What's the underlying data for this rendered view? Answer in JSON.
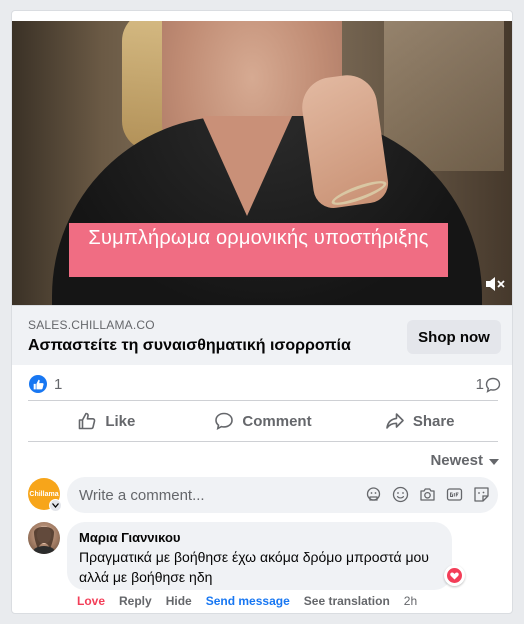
{
  "post": {
    "video_caption": "Συμπλήρωμα ορμονικής υποστήριξης",
    "link": {
      "domain": "SALES.CHILLAMA.CO",
      "headline": "Ασπαστείτε τη συναισθηματική ισορροπία",
      "cta_label": "Shop now"
    },
    "reactions": {
      "count": "1",
      "comments_count": "1"
    },
    "actions": {
      "like": "Like",
      "comment": "Comment",
      "share": "Share"
    },
    "sort_label": "Newest"
  },
  "composer": {
    "avatar_text": "Chillama",
    "placeholder": "Write a comment..."
  },
  "comments": [
    {
      "author": "Μαρια Γιαννικου",
      "text": "Πραγματικά με βοήθησε έχω ακόμα δρόμο μπροστά μου αλλά με βοήθησε ηδη",
      "actions": {
        "love": "Love",
        "reply": "Reply",
        "hide": "Hide",
        "send_message": "Send message",
        "see_translation": "See translation",
        "time": "2h"
      }
    }
  ],
  "colors": {
    "accent_blue": "#1877f2",
    "love_red": "#f33e58",
    "caption_pink": "#f06d83",
    "brand_orange": "#f7a51a"
  }
}
